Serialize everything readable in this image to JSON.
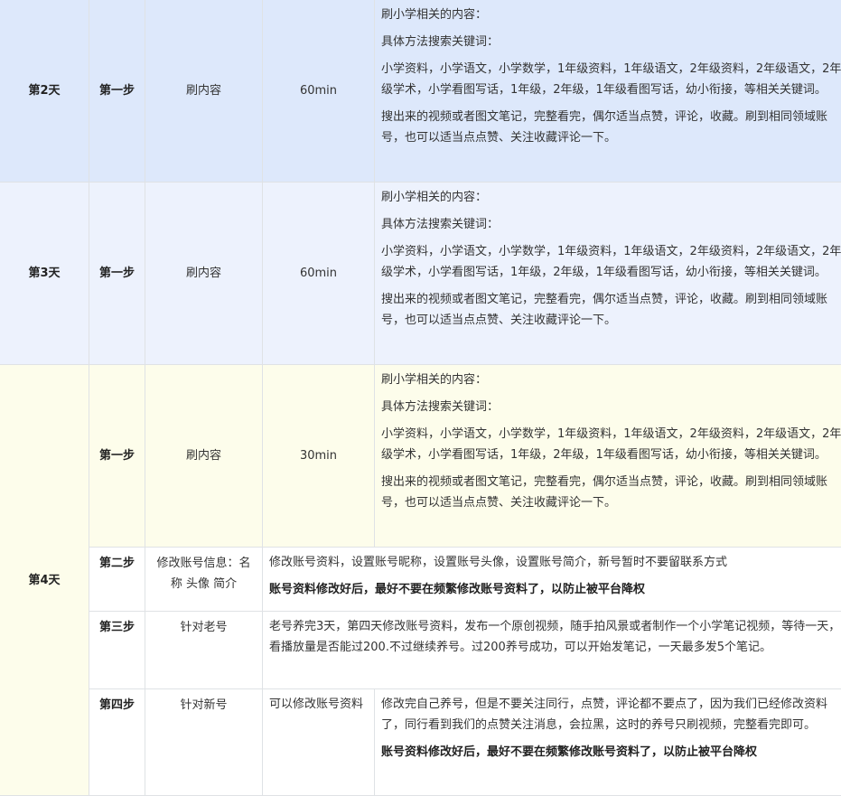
{
  "days": {
    "d2": {
      "label": "第2天",
      "step": "第一步",
      "task": "刷内容",
      "time": "60min",
      "lines": [
        "刷小学相关的内容：",
        "具体方法搜索关键词：",
        "小学资料，小学语文，小学数学，1年级资料，1年级语文，2年级资料，2年级语文，2年级学术，小学看图写话，1年级，2年级，1年级看图写话，幼小衔接，等相关关键词。",
        "搜出来的视频或者图文笔记，完整看完，偶尔适当点赞，评论，收藏。刷到相同领域账号，也可以适当点点赞、关注收藏评论一下。"
      ]
    },
    "d3": {
      "label": "第3天",
      "step": "第一步",
      "task": "刷内容",
      "time": "60min",
      "lines": [
        "刷小学相关的内容：",
        "具体方法搜索关键词：",
        "小学资料，小学语文，小学数学，1年级资料，1年级语文，2年级资料，2年级语文，2年级学术，小学看图写话，1年级，2年级，1年级看图写话，幼小衔接，等相关关键词。",
        "搜出来的视频或者图文笔记，完整看完，偶尔适当点赞，评论，收藏。刷到相同领域账号，也可以适当点点赞、关注收藏评论一下。"
      ]
    },
    "d4": {
      "label": "第4天",
      "s1": {
        "step": "第一步",
        "task": "刷内容",
        "time": "30min",
        "lines": [
          "刷小学相关的内容：",
          "具体方法搜索关键词：",
          "小学资料，小学语文，小学数学，1年级资料，1年级语文，2年级资料，2年级语文，2年级学术，小学看图写话，1年级，2年级，1年级看图写话，幼小衔接，等相关关键词。",
          "搜出来的视频或者图文笔记，完整看完，偶尔适当点赞，评论，收藏。刷到相同领域账号，也可以适当点点赞、关注收藏评论一下。"
        ]
      },
      "s2": {
        "step": "第二步",
        "task": "修改账号信息：名称 头像 简介",
        "text": "修改账号资料，设置账号昵称，设置账号头像，设置账号简介，新号暂时不要留联系方式",
        "bold": "账号资料修改好后，最好不要在频繁修改账号资料了，以防止被平台降权"
      },
      "s3": {
        "step": "第三步",
        "task": "针对老号",
        "text": "老号养完3天，第四天修改账号资料，发布一个原创视频，随手拍风景或者制作一个小学笔记视频，等待一天，看播放量是否能过200.不过继续养号。过200养号成功，可以开始发笔记，一天最多发5个笔记。"
      },
      "s4": {
        "step": "第四步",
        "task": "针对新号",
        "sub": "可以修改账号资料",
        "text": "修改完自己养号，但是不要关注同行，点赞，评论都不要点了，因为我们已经修改资料了，同行看到我们的点赞关注消息，会拉黑，这时的养号只刷视频，完整看完即可。",
        "bold": "账号资料修改好后，最好不要在频繁修改账号资料了，以防止被平台降权"
      }
    }
  }
}
